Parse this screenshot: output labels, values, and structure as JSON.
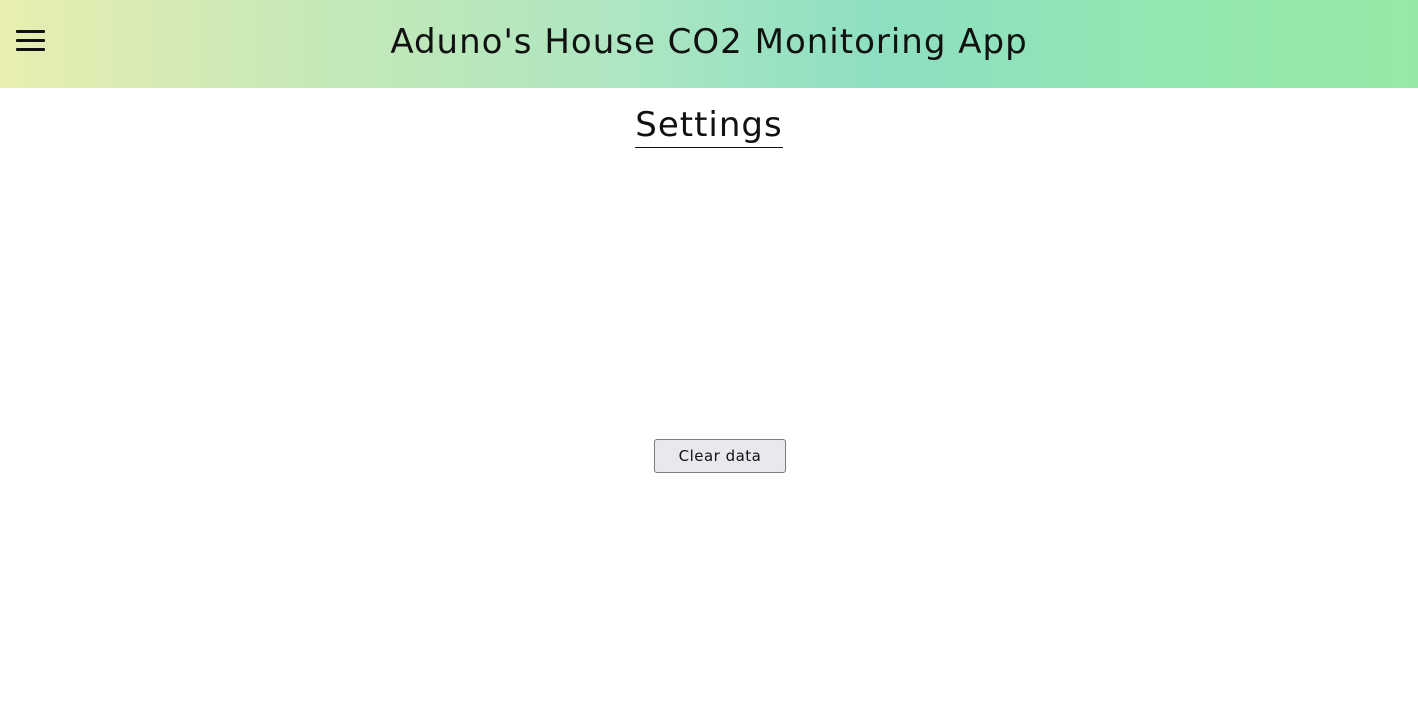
{
  "header": {
    "title": "Aduno's House CO2 Monitoring App",
    "menu_icon": "hamburger-menu-icon"
  },
  "page": {
    "title": "Settings"
  },
  "actions": {
    "clear_label": "Clear data"
  }
}
